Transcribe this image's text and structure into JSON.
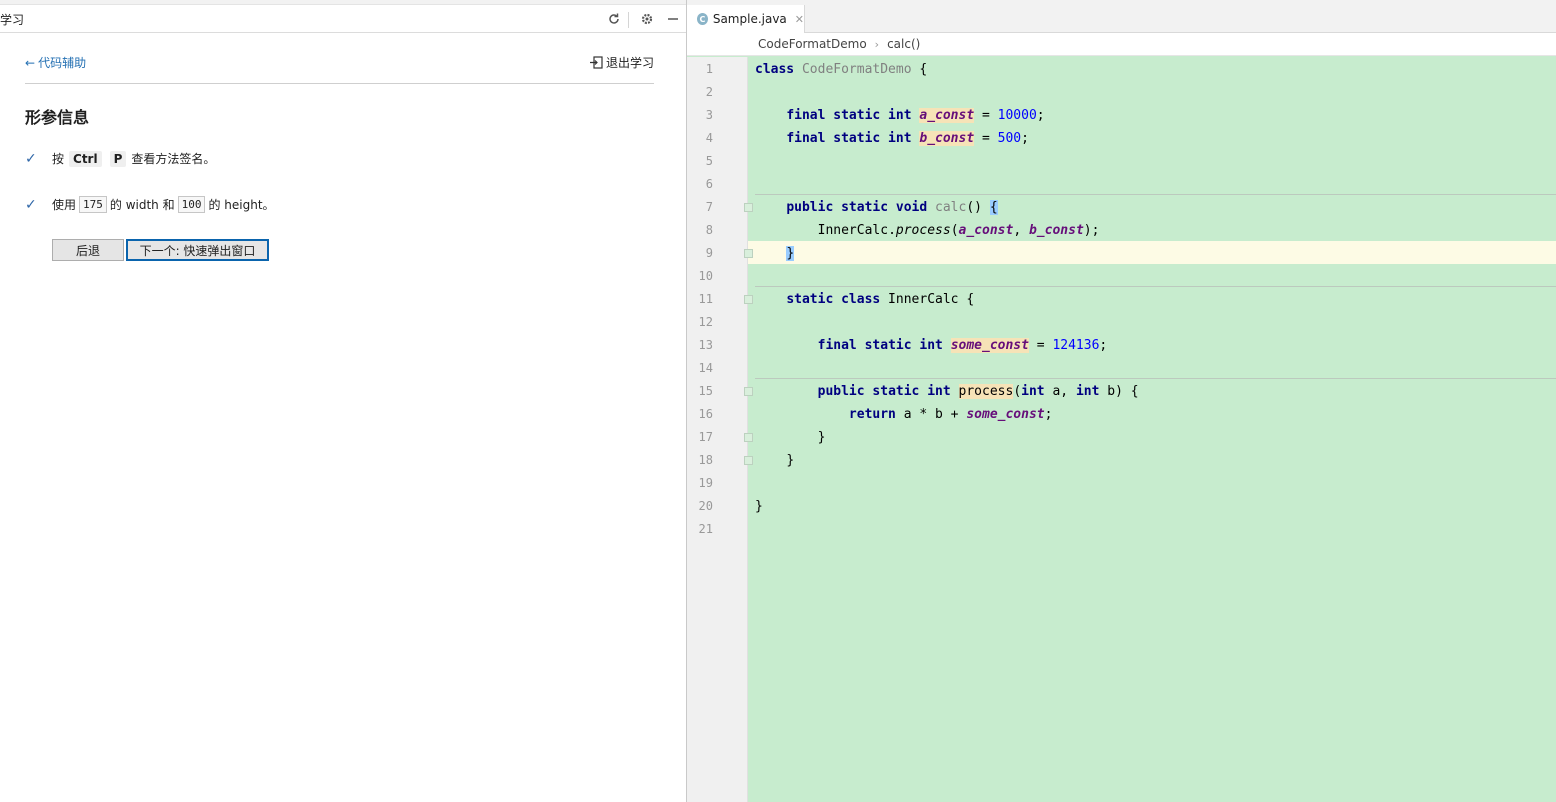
{
  "learn_panel": {
    "title": "学习",
    "back_link": "代码辅助",
    "exit_link": "退出学习",
    "lesson_title": "形参信息",
    "step1": {
      "prefix": "按",
      "key1": "Ctrl",
      "key2": "P",
      "suffix": "查看方法签名。"
    },
    "step2": {
      "prefix": "使用",
      "val1": "175",
      "mid1": "的 width 和",
      "val2": "100",
      "suffix": "的 height。"
    },
    "back_button": "后退",
    "next_button": "下一个: 快速弹出窗口"
  },
  "editor": {
    "tab_label": "Sample.java",
    "tab_icon": "C",
    "breadcrumbs": [
      "CodeFormatDemo",
      "calc()"
    ],
    "line_numbers": [
      "1",
      "2",
      "3",
      "4",
      "5",
      "6",
      "7",
      "8",
      "9",
      "10",
      "11",
      "12",
      "13",
      "14",
      "15",
      "16",
      "17",
      "18",
      "19",
      "20",
      "21"
    ],
    "code": {
      "l1_kw": "class",
      "l1_name": "CodeFormatDemo",
      "l1_rest": " {",
      "l3_kw": "final static int",
      "l3_field": "a_const",
      "l3_eq": " = ",
      "l3_num": "10000",
      "l3_end": ";",
      "l4_kw": "final static int",
      "l4_field": "b_const",
      "l4_eq": " = ",
      "l4_num": "500",
      "l4_end": ";",
      "l7_kw": "public static void",
      "l7_name": "calc",
      "l7_rest": "() ",
      "l7_brace": "{",
      "l8_obj": "InnerCalc.",
      "l8_method": "process",
      "l8_open": "(",
      "l8_arg1": "a_const",
      "l8_comma": ", ",
      "l8_arg2": "b_const",
      "l8_close": ");",
      "l9_brace": "}",
      "l11_kw": "static class",
      "l11_name": " InnerCalc {",
      "l13_kw": "final static int",
      "l13_field": "some_const",
      "l13_eq": " = ",
      "l13_num": "124136",
      "l13_end": ";",
      "l15_kw": "public static int",
      "l15_name": "process",
      "l15_p1": "(",
      "l15_int1": "int",
      "l15_a": " a, ",
      "l15_int2": "int",
      "l15_b": " b) {",
      "l16_kw": "return",
      "l16_expr": " a * b + ",
      "l16_field": "some_const",
      "l16_end": ";",
      "l17": "}",
      "l18": "}",
      "l20": "}"
    }
  }
}
